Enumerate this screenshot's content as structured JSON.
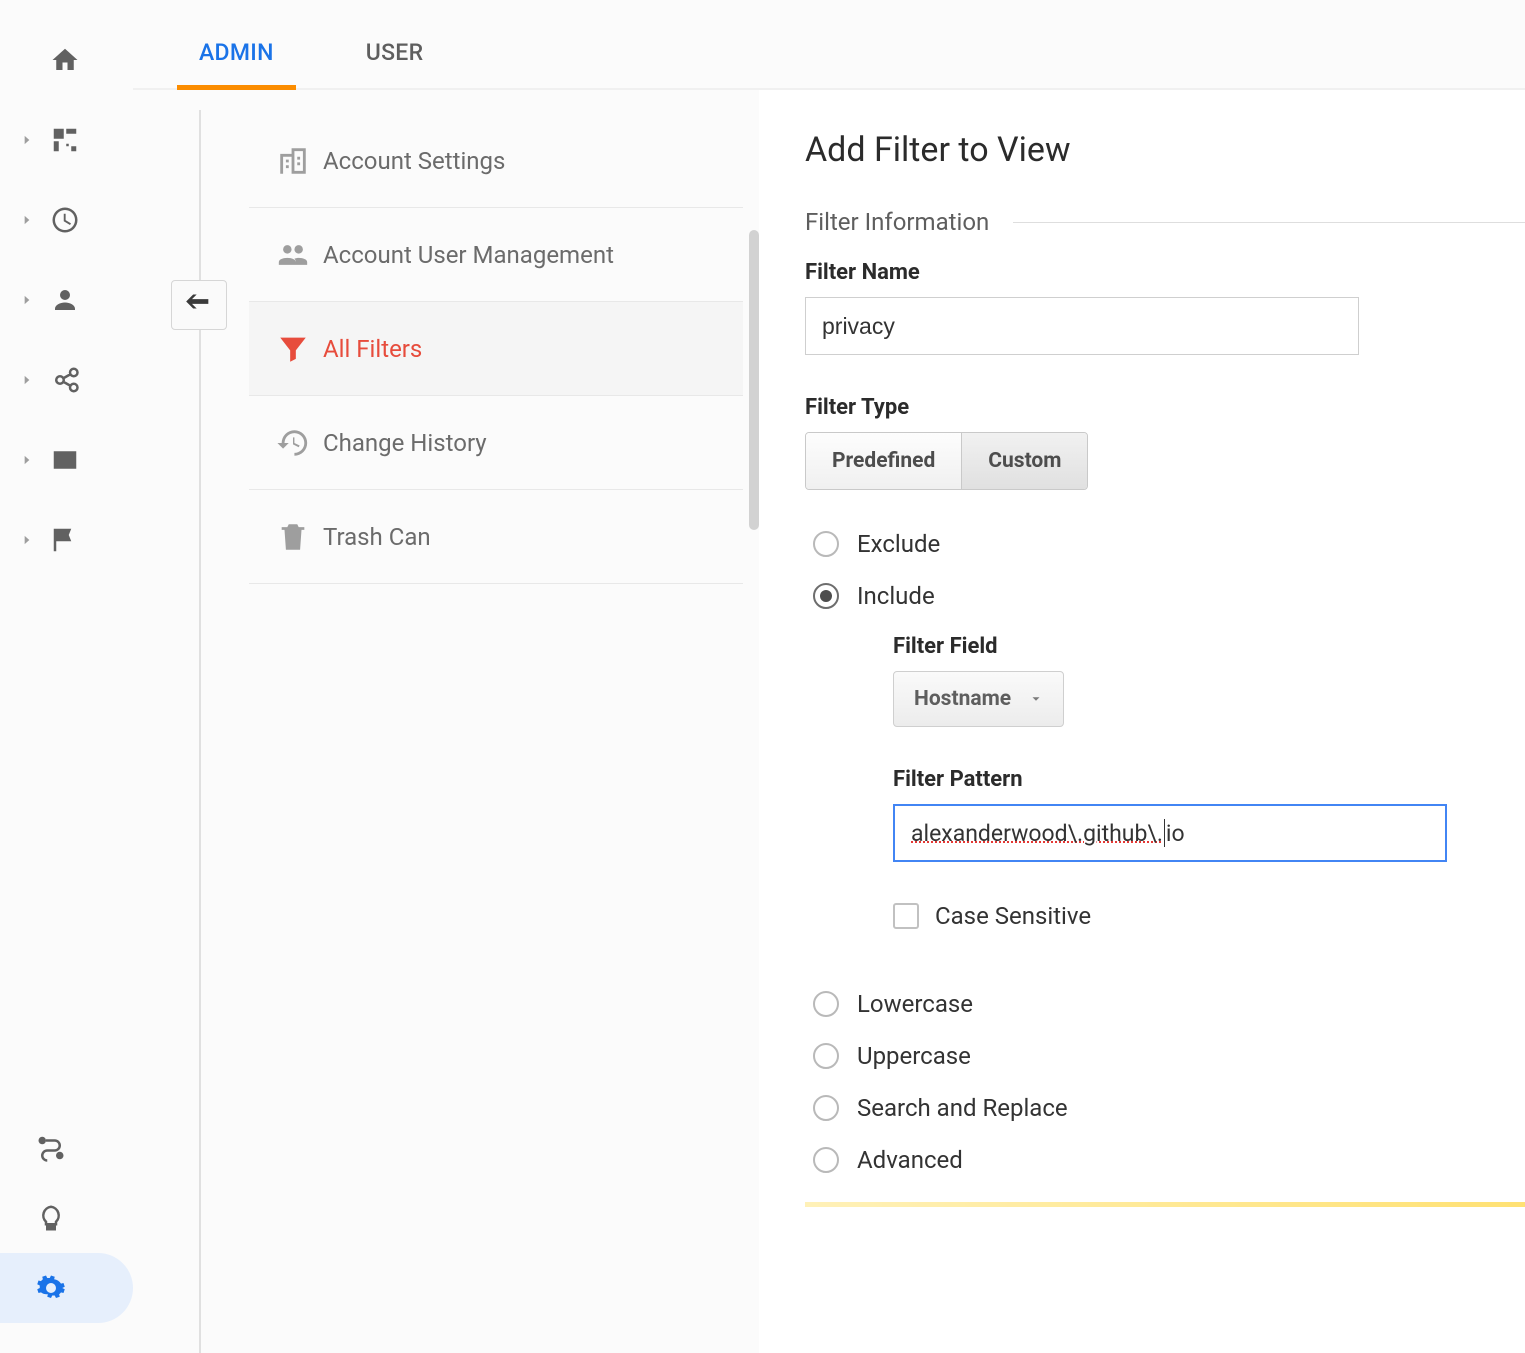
{
  "tabs": {
    "admin": "ADMIN",
    "user": "USER"
  },
  "nav": {
    "account_settings": "Account Settings",
    "user_management": "Account User Management",
    "all_filters": "All Filters",
    "change_history": "Change History",
    "trash_can": "Trash Can"
  },
  "page": {
    "title": "Add Filter to View",
    "section_info": "Filter Information",
    "filter_name_label": "Filter Name",
    "filter_name_value": "privacy",
    "filter_type_label": "Filter Type",
    "type_predefined": "Predefined",
    "type_custom": "Custom",
    "exclude": "Exclude",
    "include": "Include",
    "filter_field_label": "Filter Field",
    "filter_field_value": "Hostname",
    "filter_pattern_label": "Filter Pattern",
    "filter_pattern_value": "alexanderwood\\.github\\.io",
    "case_sensitive": "Case Sensitive",
    "lowercase": "Lowercase",
    "uppercase": "Uppercase",
    "search_replace": "Search and Replace",
    "advanced": "Advanced"
  }
}
